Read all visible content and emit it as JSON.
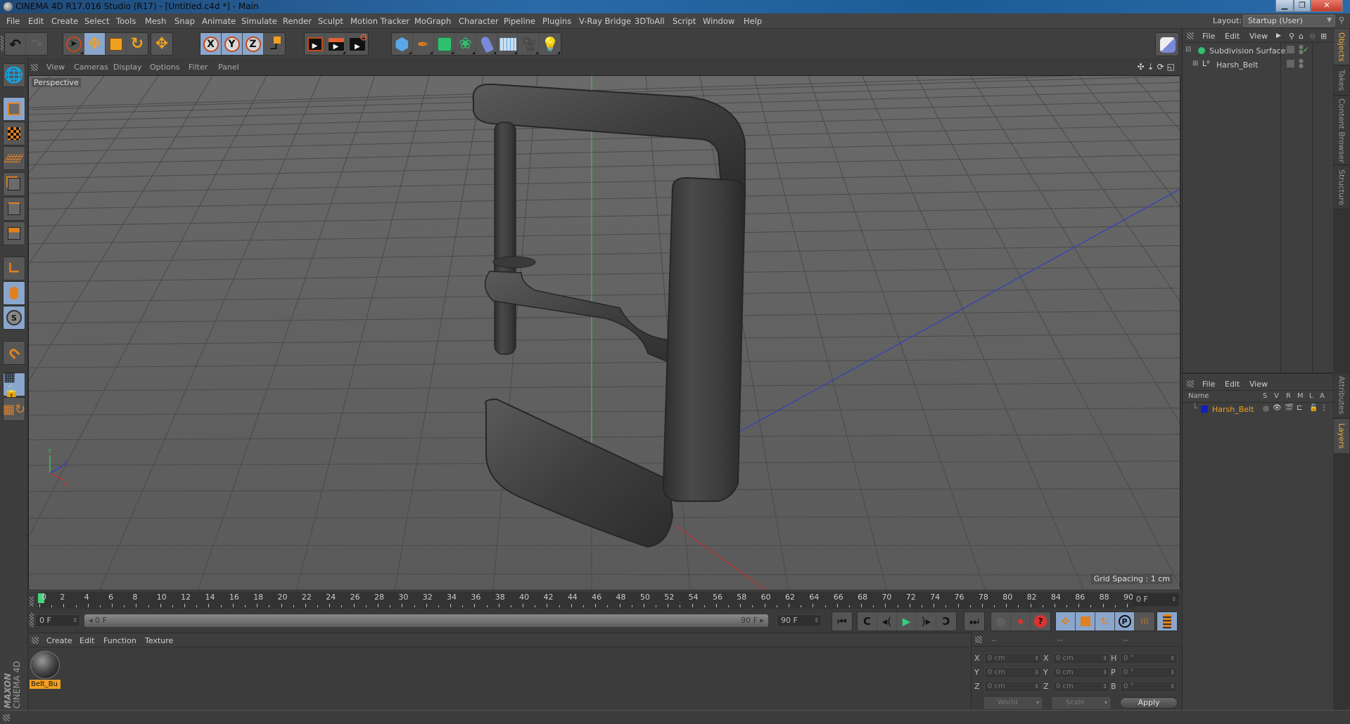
{
  "window": {
    "title": "CINEMA 4D R17.016 Studio (R17) - [Untitled.c4d *] - Main",
    "controls": [
      "minimize",
      "restore",
      "close"
    ]
  },
  "menubar": {
    "items": [
      "File",
      "Edit",
      "Create",
      "Select",
      "Tools",
      "Mesh",
      "Snap",
      "Animate",
      "Simulate",
      "Render",
      "Sculpt",
      "Motion Tracker",
      "MoGraph",
      "Character",
      "Pipeline",
      "Plugins",
      "V-Ray Bridge",
      "3DToAll",
      "Script",
      "Window",
      "Help"
    ],
    "layout_label": "Layout:",
    "layout_value": "Startup (User)"
  },
  "toolbar": {
    "groups": [
      {
        "name": "history",
        "items": [
          "undo-icon",
          "redo-icon"
        ]
      },
      {
        "name": "tools",
        "items": [
          "select-arrow-icon",
          "move-icon",
          "scale-icon",
          "rotate-icon"
        ]
      },
      {
        "name": "misc",
        "items": [
          "live-move-icon"
        ]
      },
      {
        "name": "axis",
        "items": [
          "x-axis-lock",
          "y-axis-lock",
          "z-axis-lock",
          "coordinate-system-icon"
        ]
      },
      {
        "name": "render",
        "items": [
          "render-view-icon",
          "render-picture-viewer-icon",
          "render-settings-icon"
        ]
      },
      {
        "name": "create",
        "items": [
          "cube-primitive-icon",
          "pen-spline-icon",
          "subdivision-surface-icon",
          "cloner-icon",
          "deformer-icon",
          "floor-environment-icon",
          "camera-icon",
          "light-icon"
        ]
      }
    ],
    "axis_labels": [
      "X",
      "Y",
      "Z"
    ]
  },
  "left_tools": [
    "workplane-icon",
    "model-mode-icon",
    "texture-mode-icon",
    "workplane-grid-icon",
    "points-mode-icon",
    "edges-mode-icon",
    "polygons-mode-icon",
    "axis-mode-icon",
    "tweak-mode-icon",
    "solo-icon",
    "snap-magnet-icon",
    "lock-workplane-icon",
    "workplane-rotate-icon"
  ],
  "viewport": {
    "menu": [
      "View",
      "Cameras",
      "Display",
      "Options",
      "Filter",
      "Panel"
    ],
    "label": "Perspective",
    "grid_spacing": "Grid Spacing : 1 cm",
    "nav_icons": [
      "move-view-icon",
      "dolly-view-icon",
      "rotate-view-icon",
      "maximize-view-icon"
    ],
    "axis_gizmo": [
      "Y",
      "X",
      "Z"
    ]
  },
  "timeline": {
    "ticks": [
      0,
      2,
      4,
      6,
      8,
      10,
      12,
      14,
      16,
      18,
      20,
      22,
      24,
      26,
      28,
      30,
      32,
      34,
      36,
      38,
      40,
      42,
      44,
      46,
      48,
      50,
      52,
      54,
      56,
      58,
      60,
      62,
      64,
      66,
      68,
      70,
      72,
      74,
      76,
      78,
      80,
      82,
      84,
      86,
      88,
      90
    ],
    "current_frame": 0,
    "max_frame": 90,
    "current_frame_field": "0 F",
    "start_field": "0 F",
    "range_start": "0 F",
    "range_end": "90 F",
    "end_field": "90 F"
  },
  "playback": {
    "buttons": [
      "go-to-start-icon",
      "previous-key-icon",
      "step-back-icon",
      "play-icon",
      "step-forward-icon",
      "next-key-icon",
      "go-to-end-icon"
    ],
    "record_buttons": [
      "record-disabled-icon",
      "autokey-icon",
      "keyframe-selection-icon"
    ],
    "key_buttons": [
      "key-position-icon",
      "key-scale-icon",
      "key-rotation-icon",
      "key-parameter-icon",
      "key-pla-icon"
    ],
    "timeline_button": "timeline-window-icon"
  },
  "materials": {
    "menu": [
      "Create",
      "Edit",
      "Function",
      "Texture"
    ],
    "items": [
      {
        "name": "Belt_Bu"
      }
    ]
  },
  "coordinates": {
    "headers": [
      "--",
      "--",
      "--"
    ],
    "rows": [
      {
        "a": "X",
        "av": "0 cm",
        "b": "X",
        "bv": "0 cm",
        "c": "H",
        "cv": "0 °"
      },
      {
        "a": "Y",
        "av": "0 cm",
        "b": "Y",
        "bv": "0 cm",
        "c": "P",
        "cv": "0 °"
      },
      {
        "a": "Z",
        "av": "0 cm",
        "b": "Z",
        "bv": "0 cm",
        "c": "B",
        "cv": "0 °"
      }
    ],
    "mode": "World",
    "transform": "Scale",
    "apply": "Apply"
  },
  "objects_panel": {
    "menu": [
      "File",
      "Edit",
      "View"
    ],
    "items": [
      {
        "name": "Subdivision Surface",
        "icon": "subdivision-surface-icon",
        "enabled": true
      },
      {
        "name": "Harsh_Belt",
        "icon": "null-object-icon",
        "enabled": true
      }
    ]
  },
  "layers_panel": {
    "menu": [
      "File",
      "Edit",
      "View"
    ],
    "columns": [
      "Name",
      "S",
      "V",
      "R",
      "M",
      "L",
      "A"
    ],
    "items": [
      {
        "name": "Harsh_Belt",
        "color": "#1020c0"
      }
    ]
  },
  "right_tabs": {
    "top": [
      "Objects",
      "Takes",
      "Content Browser",
      "Structure"
    ],
    "bottom": [
      "Attributes",
      "Layers"
    ],
    "active": [
      "Objects",
      "Layers"
    ]
  },
  "branding": {
    "line1": "MAXON",
    "line2": "CINEMA 4D"
  },
  "colors": {
    "accent": "#f0a020",
    "active_tool": "#8aa6cc",
    "playhead": "#44d47a",
    "layer_name": "#f0a020"
  }
}
